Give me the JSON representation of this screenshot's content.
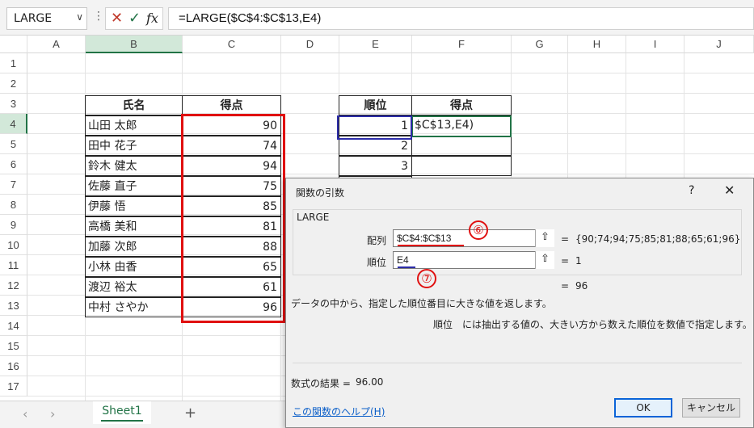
{
  "formula_bar": {
    "name_box": "LARGE",
    "name_box_dropdown": "∨",
    "cancel_glyph": "✕",
    "enter_glyph": "✓",
    "fx_label": "fx",
    "formula": "=LARGE($C$4:$C$13,E4)"
  },
  "columns": [
    "A",
    "B",
    "C",
    "D",
    "E",
    "F",
    "G",
    "H",
    "I",
    "J"
  ],
  "rows": [
    "1",
    "2",
    "3",
    "4",
    "5",
    "6",
    "7",
    "8",
    "9",
    "10",
    "11",
    "12",
    "13",
    "14",
    "15",
    "16",
    "17"
  ],
  "table1": {
    "headers": [
      "氏名",
      "得点"
    ],
    "rows": [
      {
        "name": "山田 太郎",
        "score": "90"
      },
      {
        "name": "田中 花子",
        "score": "74"
      },
      {
        "name": "鈴木 健太",
        "score": "94"
      },
      {
        "name": "佐藤 直子",
        "score": "75"
      },
      {
        "name": "伊藤 悟",
        "score": "85"
      },
      {
        "name": "高橋 美和",
        "score": "81"
      },
      {
        "name": "加藤 次郎",
        "score": "88"
      },
      {
        "name": "小林 由香",
        "score": "65"
      },
      {
        "name": "渡辺 裕太",
        "score": "61"
      },
      {
        "name": "中村 さやか",
        "score": "96"
      }
    ]
  },
  "table2": {
    "headers": [
      "順位",
      "得点"
    ],
    "ranks": [
      "1",
      "2",
      "3"
    ],
    "editing_cell": "$C$13,E4)"
  },
  "sheet_tabs": {
    "active": "Sheet1",
    "add": "+"
  },
  "dialog": {
    "title": "関数の引数",
    "help_glyph": "?",
    "close_glyph": "✕",
    "function_name": "LARGE",
    "args": [
      {
        "label": "配列",
        "value": "$C$4:$C$13",
        "result": "{90;74;94;75;85;81;88;65;61;96}"
      },
      {
        "label": "順位",
        "value": "E4",
        "result": "1"
      }
    ],
    "eq": "=",
    "function_result": "96",
    "description": "データの中から、指定した順位番目に大きな値を返します。",
    "arg_help_label": "順位",
    "arg_help_text": "には抽出する値の、大きい方から数えた順位を数値で指定します。",
    "formula_result_label": "数式の結果 =",
    "formula_result_value": "96.00",
    "help_link": "この関数のヘルプ(H)",
    "ok": "OK",
    "cancel": "キャンセル"
  },
  "annotations": [
    "⑥",
    "⑦"
  ],
  "colors": {
    "excel_green": "#217346",
    "highlight_red": "#e01010",
    "highlight_blue": "#2c2ca8"
  }
}
